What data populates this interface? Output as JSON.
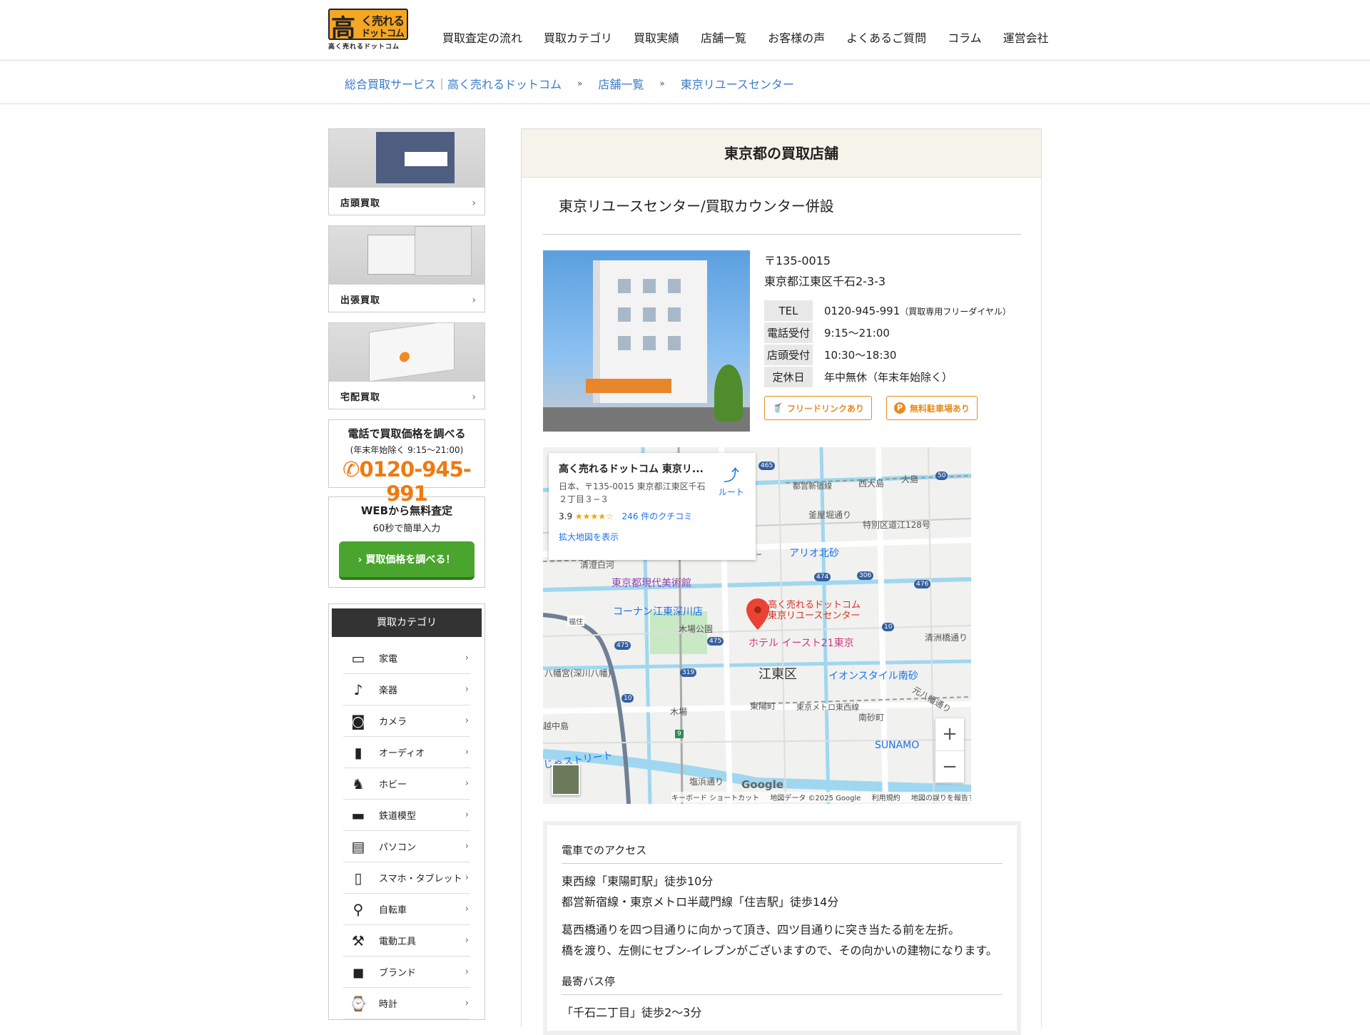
{
  "header": {
    "logo": {
      "line1": "高",
      "line2": "く売れる",
      "line3": "ドットコム",
      "sub": "高く売れるドットコム"
    },
    "nav": [
      "買取査定の流れ",
      "買取カテゴリ",
      "買取実績",
      "店舗一覧",
      "お客様の声",
      "よくあるご質問",
      "コラム",
      "運営会社"
    ]
  },
  "breadcrumb": [
    "総合買取サービス｜高く売れるドットコム",
    "店舗一覧",
    "東京リユースセンター"
  ],
  "breadcrumb_sep": "»",
  "sidebar": {
    "services": [
      {
        "label": "店頭買取",
        "icon": "store-photo"
      },
      {
        "label": "出張買取",
        "icon": "truck-photo"
      },
      {
        "label": "宅配買取",
        "icon": "box-photo"
      }
    ],
    "tel": {
      "title": "電話で買取価格を調べる",
      "hours": "(年末年始除く 9:15〜21:00)",
      "number": "0120-945-991"
    },
    "web": {
      "title": "WEBから無料査定",
      "sub": "60秒で簡単入力",
      "button": "買取価格を調べる！"
    },
    "category": {
      "title": "買取カテゴリ",
      "items": [
        {
          "label": "家電",
          "icon": "microwave-icon"
        },
        {
          "label": "楽器",
          "icon": "guitar-icon"
        },
        {
          "label": "カメラ",
          "icon": "camera-icon"
        },
        {
          "label": "オーディオ",
          "icon": "speaker-icon"
        },
        {
          "label": "ホビー",
          "icon": "figure-icon"
        },
        {
          "label": "鉄道模型",
          "icon": "train-icon"
        },
        {
          "label": "パソコン",
          "icon": "laptop-icon"
        },
        {
          "label": "スマホ・タブレット",
          "icon": "smartphone-icon"
        },
        {
          "label": "自転車",
          "icon": "bicycle-icon"
        },
        {
          "label": "電動工具",
          "icon": "drill-icon"
        },
        {
          "label": "ブランド",
          "icon": "bag-icon"
        },
        {
          "label": "時計",
          "icon": "watch-icon"
        }
      ]
    }
  },
  "main": {
    "title": "東京都の買取店舗",
    "store_name": "東京リユースセンター/買取カウンター併設",
    "postal": "〒135-0015",
    "address": "東京都江東区千石2-3-3",
    "rows": [
      {
        "key": "TEL",
        "value": "0120-945-991",
        "note": "（買取専用フリーダイヤル）"
      },
      {
        "key": "電話受付",
        "value": "9:15〜21:00",
        "note": ""
      },
      {
        "key": "店頭受付",
        "value": "10:30〜18:30",
        "note": ""
      },
      {
        "key": "定休日",
        "value": "年中無休（年末年始除く）",
        "note": ""
      }
    ],
    "badges": [
      {
        "label": "フリードリンクあり",
        "icon": "drink-icon"
      },
      {
        "label": "無料駐車場あり",
        "icon": "parking-icon",
        "glyph": "P"
      }
    ]
  },
  "map": {
    "card": {
      "name": "高く売れるドットコム 東京リ...",
      "address": "日本、〒135-0015 東京都江東区千石２丁目３−３",
      "rating": "3.9",
      "stars": "★★★★☆",
      "reviews": "246 件のクチコミ",
      "enlarge": "拡大地図を表示",
      "route": "ルート"
    },
    "labels": {
      "pin": "高く売れるドットコム\n東京リユースセンター",
      "koto": "江東区",
      "hotel": "ホテル イースト21東京",
      "aeon": "イオンスタイル南砂",
      "ario": "アリオ北砂",
      "konan": "コーナン江東深川店",
      "museum": "東京都現代美術館",
      "kiba_park": "木場公園",
      "kiba": "木場",
      "hachimangu": "八幡宮(深川八幡)",
      "toyocho": "東陽町",
      "minamisunamachi": "南砂町",
      "sunamo": "SUNAMO",
      "nishiojima": "西大島",
      "ojima": "大島",
      "kiyosumi": "清澄白河",
      "kamasaki": "釜屋堀通り",
      "tokubetsu": "特別区道江128号",
      "kiyosu": "清洲橋通り",
      "motohachiman": "元八幡通り",
      "shiohama": "塩浜通り",
      "etchujima": "越中島",
      "shinjuku_line": "都営新宿線",
      "tozai_line": "東京メトロ東西線",
      "fukagawa": "じゃストリート",
      "r465": "465",
      "r50": "50",
      "r474": "474",
      "r306": "306",
      "r476": "476",
      "r10a": "10",
      "r10b": "10",
      "r475a": "475",
      "r475b": "475",
      "r319": "319",
      "r9": "9",
      "fukuzumi": "福住"
    },
    "footer": [
      "キーボード ショートカット",
      "地図データ ©2025 Google",
      "利用規約",
      "地図の誤りを報告する"
    ],
    "google": "Google",
    "zoom_in": "+",
    "zoom_out": "−"
  },
  "access": {
    "train_heading": "電車でのアクセス",
    "train_lines": [
      "東西線「東陽町駅」徒歩10分",
      "都営新宿線・東京メトロ半蔵門線「住吉駅」徒歩14分"
    ],
    "directions": [
      "葛西橋通りを四つ目通りに向かって頂き、四ツ目通りに突き当たる前を左折。",
      "橋を渡り、左側にセブン-イレブンがございますので、その向かいの建物になります。"
    ],
    "bus_heading": "最寄バス停",
    "bus_lines": [
      "「千石二丁目」徒歩2〜3分"
    ]
  },
  "colors": {
    "accent": "#ee7a10",
    "link": "#3a7bc8",
    "green": "#4aa52e"
  }
}
